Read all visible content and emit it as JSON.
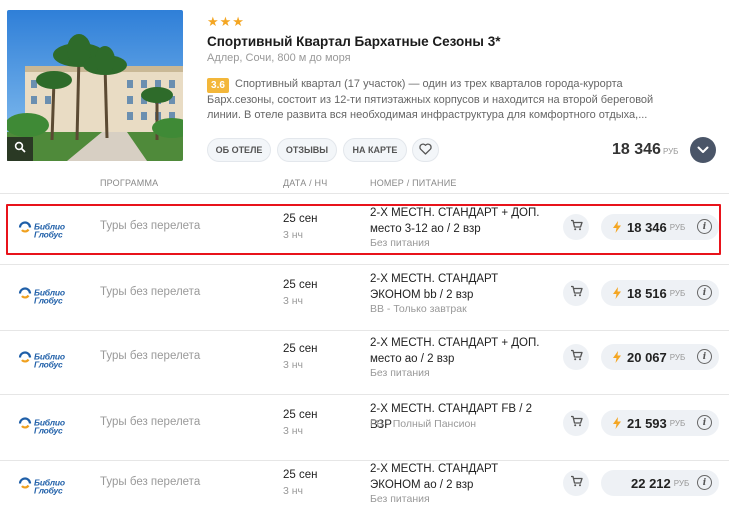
{
  "hotel": {
    "stars": "★★★",
    "name": "Спортивный Квартал Бархатные Сезоны 3*",
    "location": "Адлер, Сочи, 800 м до моря",
    "rating": "3.6",
    "description": "Спортивный квартал (17 участок) — один из трех кварталов города-курорта Барх.сезоны, состоит из 12-ти пятиэтажных корпусов и находится на второй береговой линии. В отеле развита вся необходимая инфраструктура для комфортного отдыха,...",
    "buttons": {
      "about": "Об отеле",
      "reviews": "Отзывы",
      "map": "На карте"
    },
    "price": "18 346",
    "currency": "РУБ"
  },
  "table": {
    "headers": {
      "program": "Программа",
      "date": "Дата / нч",
      "room": "Номер / питание"
    }
  },
  "operator": {
    "logo_line1": "Библио",
    "logo_line2": "Глобус"
  },
  "offers": [
    {
      "program": "Туры без перелета",
      "date": "25 сен",
      "nights": "3 нч",
      "room_upper": "2-Х МЕСТН. СТАНДАРТ + доп.",
      "room_lower": "место 3-12 ао / 2 взр",
      "meal": "Без питания",
      "price": "18 346",
      "currency": "РУБ",
      "bolt": true,
      "selected": true
    },
    {
      "program": "Туры без перелета",
      "date": "25 сен",
      "nights": "3 нч",
      "room_upper": "2-Х МЕСТН. СТАНДАРТ",
      "room_lower": "ЭКОНОМ bb / 2 взр",
      "meal": "BB - Только завтрак",
      "price": "18 516",
      "currency": "РУБ",
      "bolt": true,
      "selected": false
    },
    {
      "program": "Туры без перелета",
      "date": "25 сен",
      "nights": "3 нч",
      "room_upper": "2-Х МЕСТН. СТАНДАРТ + доп.",
      "room_lower": "место ао / 2 взр",
      "meal": "Без питания",
      "price": "20 067",
      "currency": "РУБ",
      "bolt": true,
      "selected": false
    },
    {
      "program": "Туры без перелета",
      "date": "25 сен",
      "nights": "3 нч",
      "room_upper": "2-Х МЕСТН. СТАНДАРТ fb / 2 взр",
      "room_lower": "",
      "meal": "FB - Полный Пансион",
      "price": "21 593",
      "currency": "РУБ",
      "bolt": true,
      "selected": false
    },
    {
      "program": "Туры без перелета",
      "date": "25 сен",
      "nights": "3 нч",
      "room_upper": "2-Х МЕСТН. СТАНДАРТ",
      "room_lower": "ЭКОНОМ ао / 2 взр",
      "meal": "Без питания",
      "price": "22 212",
      "currency": "РУБ",
      "bolt": false,
      "selected": false
    }
  ],
  "colors": {
    "accent_star": "#f4a623",
    "bolt": "#f4a623",
    "selection_border": "#e8131b",
    "operator_blue": "#1f5fa8"
  },
  "icons": {
    "zoom": "search-icon",
    "favorite": "heart-icon",
    "expand": "chevron-down-icon",
    "cart": "cart-icon",
    "bolt": "lightning-icon",
    "info": "info-icon"
  }
}
